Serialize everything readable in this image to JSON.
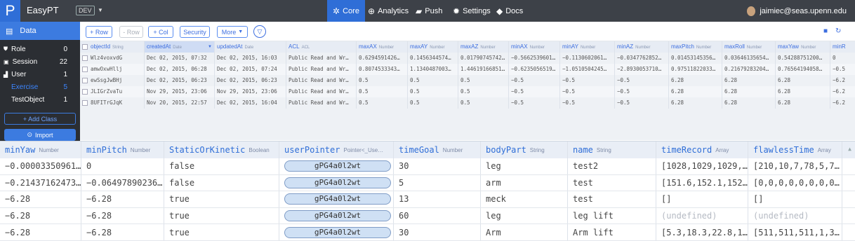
{
  "app": {
    "name": "EasyPT",
    "env": "DEV",
    "logo_glyph": "P"
  },
  "nav": [
    {
      "label": "Core",
      "icon": "gear-icon",
      "active": true
    },
    {
      "label": "Analytics",
      "icon": "analytics-icon"
    },
    {
      "label": "Push",
      "icon": "chat-icon"
    },
    {
      "label": "Settings",
      "icon": "settings-icon"
    },
    {
      "label": "Docs",
      "icon": "docs-icon"
    }
  ],
  "user": {
    "email": "jaimiec@seas.upenn.edu"
  },
  "sidebar": {
    "section": "Data",
    "classes": [
      {
        "name": "Role",
        "count": "0"
      },
      {
        "name": "Session",
        "count": "22"
      },
      {
        "name": "User",
        "count": "1"
      }
    ],
    "subclasses": [
      {
        "name": "Exercise",
        "count": "5",
        "active": true
      },
      {
        "name": "TestObject",
        "count": "1"
      }
    ],
    "add_class": "+ Add Class",
    "import": "Import"
  },
  "toolbar": {
    "add_row": "+ Row",
    "del_row": "- Row",
    "add_col": "+ Col",
    "security": "Security",
    "more": "More"
  },
  "grid_top": {
    "columns": [
      {
        "name": "objectId",
        "type": "String"
      },
      {
        "name": "createdAt",
        "type": "Date"
      },
      {
        "name": "updatedAt",
        "type": "Date"
      },
      {
        "name": "ACL",
        "type": "ACL"
      },
      {
        "name": "maxAX",
        "type": "Number"
      },
      {
        "name": "maxAY",
        "type": "Number"
      },
      {
        "name": "maxAZ",
        "type": "Number"
      },
      {
        "name": "minAX",
        "type": "Number"
      },
      {
        "name": "minAY",
        "type": "Number"
      },
      {
        "name": "minAZ",
        "type": "Number"
      },
      {
        "name": "maxPitch",
        "type": "Number"
      },
      {
        "name": "maxRoll",
        "type": "Number"
      },
      {
        "name": "maxYaw",
        "type": "Number"
      },
      {
        "name": "minR",
        "type": ""
      }
    ],
    "rows": [
      [
        "Wlz4voxvdG",
        "Dec 02, 2015, 07:32",
        "Dec 02, 2015, 16:03",
        "Public Read and Wr…",
        "0.6294591426…",
        "0.1456344574…",
        "0.01790745742…",
        "−0.5662539601…",
        "−0.1130602061…",
        "−0.0347762852…",
        "0.01453145356…",
        "0.03646135654…",
        "0.54288751200…",
        "0"
      ],
      [
        "amwOxwHllj",
        "Dec 02, 2015, 06:28",
        "Dec 02, 2015, 07:24",
        "Public Read and Wr…",
        "0.8074533343…",
        "1.1340487003…",
        "1.44619166851…",
        "−0.6235056519…",
        "−1.0510504245…",
        "−2.8930053710…",
        "0.97511822033…",
        "0.21679283204…",
        "0.76564194058…",
        "−0.5"
      ],
      [
        "ewSsgJwBHj",
        "Dec 02, 2015, 06:23",
        "Dec 02, 2015, 06:23",
        "Public Read and Wr…",
        "0.5",
        "0.5",
        "0.5",
        "−0.5",
        "−0.5",
        "−0.5",
        "6.28",
        "6.28",
        "6.28",
        "−6.2"
      ],
      [
        "JLIGrZvaTu",
        "Nov 29, 2015, 23:06",
        "Nov 29, 2015, 23:06",
        "Public Read and Wr…",
        "0.5",
        "0.5",
        "0.5",
        "−0.5",
        "−0.5",
        "−0.5",
        "6.28",
        "6.28",
        "6.28",
        "−6.2"
      ],
      [
        "8UFITrGJqK",
        "Nov 20, 2015, 22:57",
        "Dec 02, 2015, 16:04",
        "Public Read and Wr…",
        "0.5",
        "0.5",
        "0.5",
        "−0.5",
        "−0.5",
        "−0.5",
        "6.28",
        "6.28",
        "6.28",
        "−6.2"
      ]
    ]
  },
  "grid_bottom": {
    "columns": [
      {
        "name": "minYaw",
        "type": "Number"
      },
      {
        "name": "minPitch",
        "type": "Number"
      },
      {
        "name": "StaticOrKinetic",
        "type": "Boolean"
      },
      {
        "name": "userPointer",
        "type": "Pointer<_Use…"
      },
      {
        "name": "timeGoal",
        "type": "Number"
      },
      {
        "name": "bodyPart",
        "type": "String"
      },
      {
        "name": "name",
        "type": "String"
      },
      {
        "name": "timeRecord",
        "type": "Array"
      },
      {
        "name": "flawlessTime",
        "type": "Array"
      }
    ],
    "rows": [
      [
        "−0.00003350961…",
        "0",
        "false",
        "gPG4a0l2wt",
        "30",
        "leg",
        "test2",
        "[1028,1029,1029,…",
        "[210,10,7,78,5,7…"
      ],
      [
        "−0.21437162473…",
        "−0.06497890236…",
        "false",
        "gPG4a0l2wt",
        "5",
        "arm",
        "test",
        "[151.6,152.1,152…",
        "[0,0,0,0,0,0,0,0…"
      ],
      [
        "−6.28",
        "−6.28",
        "true",
        "gPG4a0l2wt",
        "13",
        "meck",
        "test",
        "[]",
        "[]"
      ],
      [
        "−6.28",
        "−6.28",
        "true",
        "gPG4a0l2wt",
        "60",
        "leg",
        "leg lift",
        "(undefined)",
        "(undefined)"
      ],
      [
        "−6.28",
        "−6.28",
        "true",
        "gPG4a0l2wt",
        "30",
        "Arm",
        "Arm lift",
        "[5.3,18.3,22.8,1…",
        "[511,511,511,1,3…"
      ]
    ]
  }
}
